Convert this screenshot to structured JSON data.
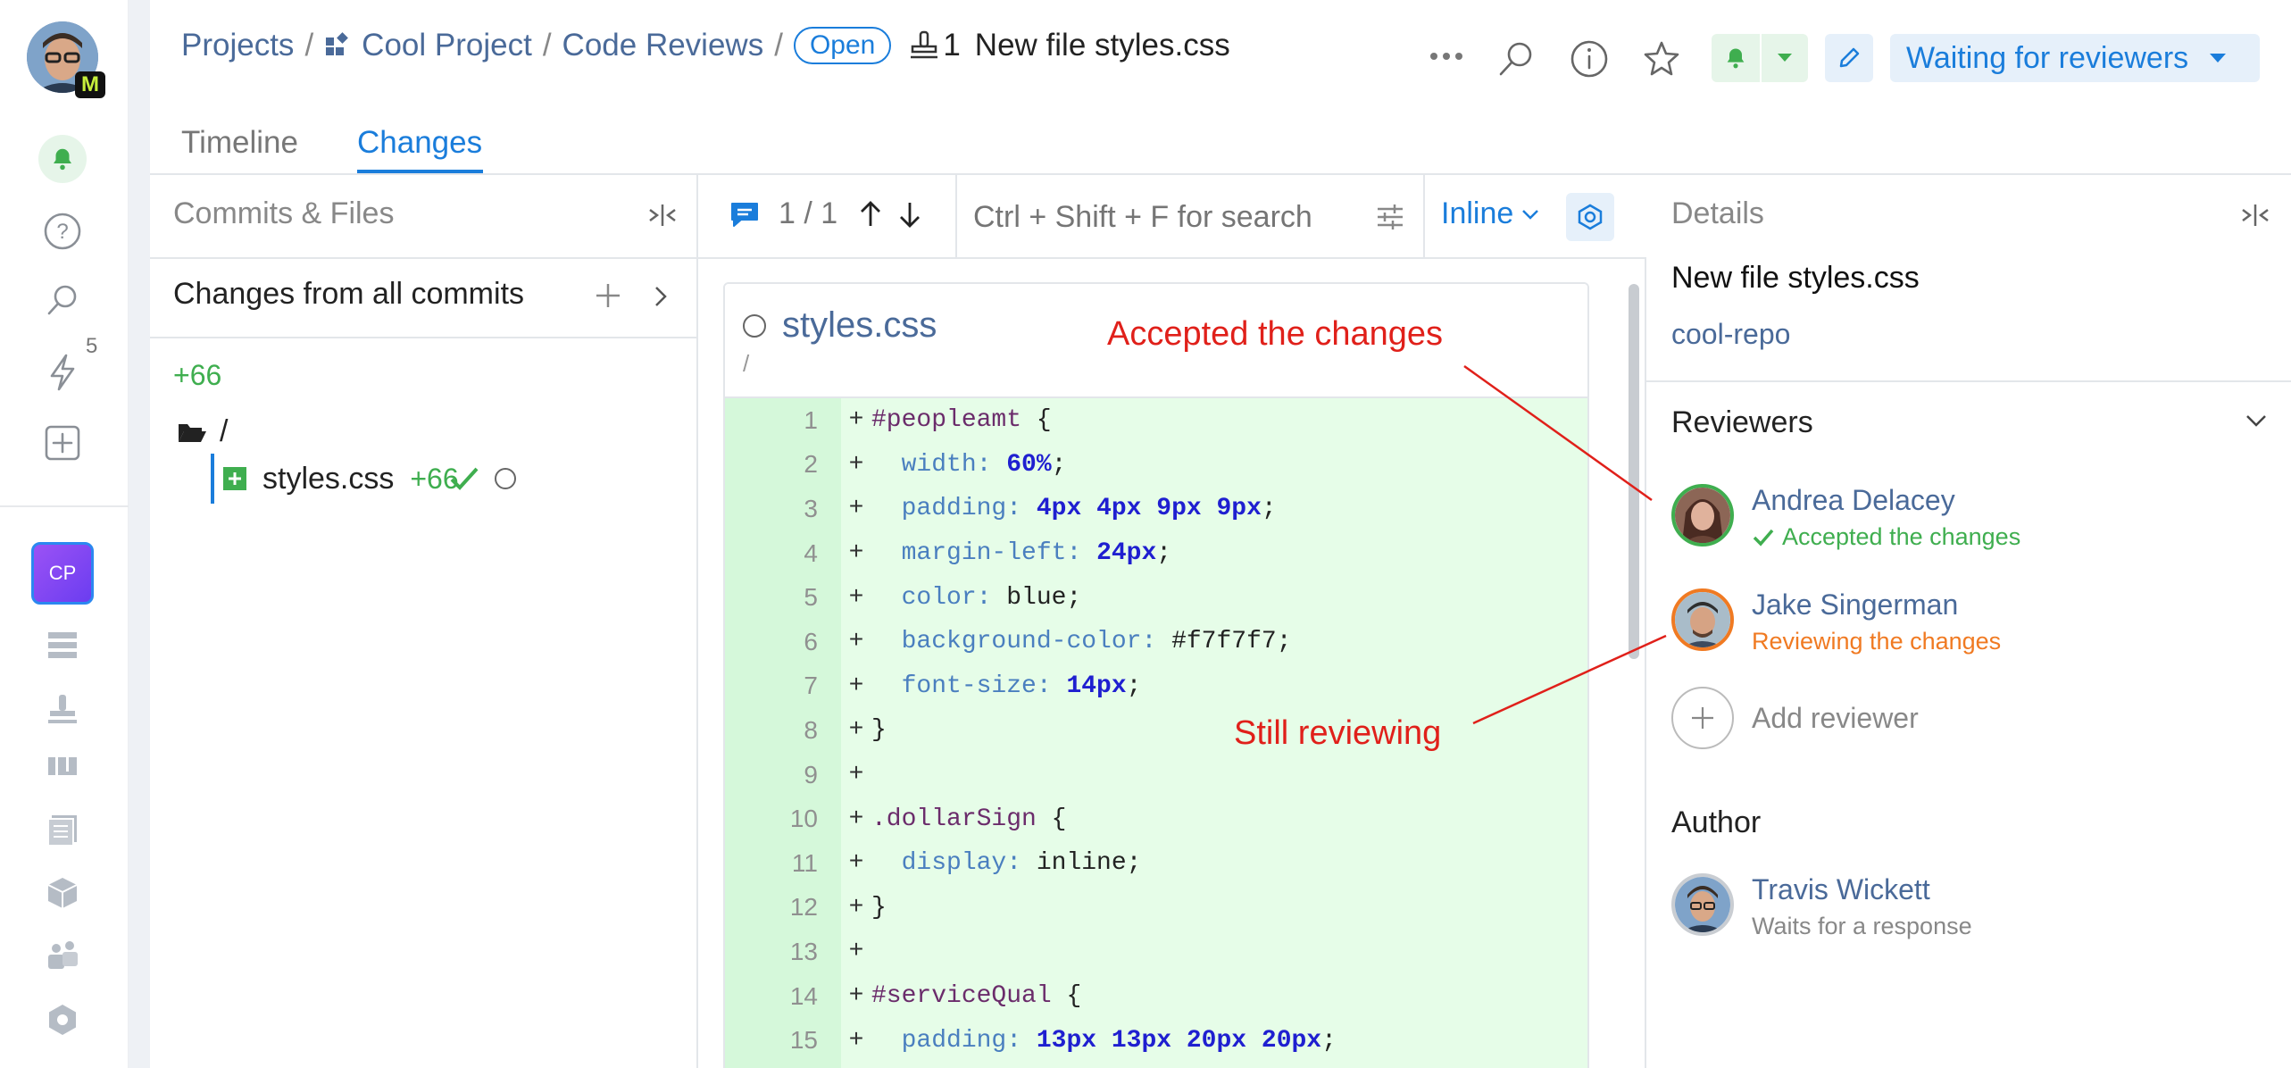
{
  "header": {
    "breadcrumb": {
      "projects": "Projects",
      "sep1": "/",
      "project": "Cool Project",
      "sep2": "/",
      "section": "Code Reviews",
      "sep3": "/",
      "status_badge": "Open",
      "review_number": "1",
      "title": "New file styles.css"
    },
    "state_button": "Waiting for reviewers"
  },
  "tabs": [
    {
      "label": "Timeline",
      "active": false
    },
    {
      "label": "Changes",
      "active": true
    }
  ],
  "left_nav": {
    "badge_count": "5",
    "project_avatar": "CP"
  },
  "commits_panel": {
    "title": "Commits & Files",
    "changes_label": "Changes from all commits",
    "total_added": "+66",
    "folder": "/",
    "file": {
      "name": "styles.css",
      "added": "+66"
    }
  },
  "diff_toolbar": {
    "comment_position": "1 / 1",
    "search_placeholder": "Ctrl + Shift + F for search",
    "view_mode": "Inline"
  },
  "diff": {
    "file_name": "styles.css",
    "file_path": "/",
    "lines": [
      {
        "n": "1",
        "code": "#peopleamt {"
      },
      {
        "n": "2",
        "code": "  width: 60%;"
      },
      {
        "n": "3",
        "code": "  padding: 4px 4px 9px 9px;"
      },
      {
        "n": "4",
        "code": "  margin-left: 24px;"
      },
      {
        "n": "5",
        "code": "  color: blue;"
      },
      {
        "n": "6",
        "code": "  background-color: #f7f7f7;"
      },
      {
        "n": "7",
        "code": "  font-size: 14px;"
      },
      {
        "n": "8",
        "code": "}"
      },
      {
        "n": "9",
        "code": ""
      },
      {
        "n": "10",
        "code": ".dollarSign {"
      },
      {
        "n": "11",
        "code": "  display: inline;"
      },
      {
        "n": "12",
        "code": "}"
      },
      {
        "n": "13",
        "code": ""
      },
      {
        "n": "14",
        "code": "#serviceQual {"
      },
      {
        "n": "15",
        "code": "  padding: 13px 13px 20px 20px;"
      }
    ]
  },
  "annotations": {
    "accepted": "Accepted the changes",
    "reviewing": "Still reviewing"
  },
  "details": {
    "title": "Details",
    "review_title": "New file styles.css",
    "repo": "cool-repo",
    "reviewers_heading": "Reviewers",
    "reviewers": [
      {
        "name": "Andrea Delacey",
        "status": "Accepted the changes",
        "status_color": "#3fae4f"
      },
      {
        "name": "Jake Singerman",
        "status": "Reviewing the changes",
        "status_color": "#f07a22"
      }
    ],
    "add_reviewer": "Add reviewer",
    "author_heading": "Author",
    "author": {
      "name": "Travis Wickett",
      "status": "Waits for a response"
    }
  },
  "colors": {
    "accent": "#1a7ddb",
    "link": "#4a6a99",
    "added_bg": "#e6fde8",
    "added_gutter": "#d5f8da",
    "annotation_red": "#e0201a",
    "green": "#3fae4f"
  }
}
